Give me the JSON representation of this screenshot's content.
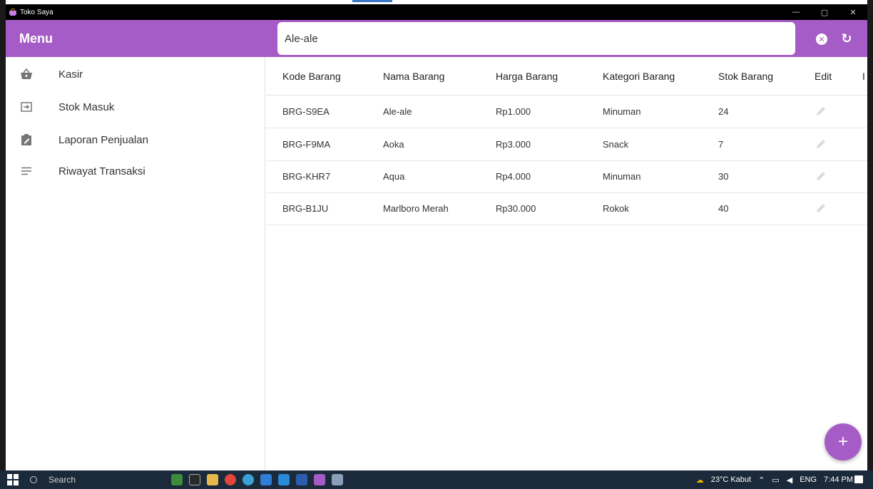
{
  "window": {
    "title": "Toko Saya",
    "controls": {
      "minimize": "—",
      "maximize": "▢",
      "close": "✕"
    }
  },
  "menu": {
    "title": "Menu",
    "items": [
      {
        "label": "Kasir",
        "icon": "basket-icon"
      },
      {
        "label": "Stok Masuk",
        "icon": "login-icon"
      },
      {
        "label": "Laporan Penjualan",
        "icon": "clipboard-edit-icon"
      },
      {
        "label": "Riwayat Transaksi",
        "icon": "list-icon"
      }
    ]
  },
  "search": {
    "value": "Ale-ale",
    "clear_icon": "close-circle-icon",
    "refresh_icon": "refresh-icon"
  },
  "table": {
    "headers": [
      "Kode Barang",
      "Nama Barang",
      "Harga Barang",
      "Kategori Barang",
      "Stok Barang",
      "Edit",
      "I"
    ],
    "rows": [
      {
        "kode": "BRG-S9EA",
        "nama": "Ale-ale",
        "harga": "Rp1.000",
        "kategori": "Minuman",
        "stok": "24"
      },
      {
        "kode": "BRG-F9MA",
        "nama": "Aoka",
        "harga": "Rp3.000",
        "kategori": "Snack",
        "stok": "7"
      },
      {
        "kode": "BRG-KHR7",
        "nama": "Aqua",
        "harga": "Rp4.000",
        "kategori": "Minuman",
        "stok": "30"
      },
      {
        "kode": "BRG-B1JU",
        "nama": "Marlboro Merah",
        "harga": "Rp30.000",
        "kategori": "Rokok",
        "stok": "40"
      }
    ]
  },
  "fab": {
    "label": "+"
  },
  "taskbar": {
    "search_label": "Search",
    "weather": "23°C Kabut",
    "language": "ENG",
    "time": "7:44 PM"
  },
  "colors": {
    "accent": "#a65cc6",
    "taskbar": "#1b2a3a"
  }
}
